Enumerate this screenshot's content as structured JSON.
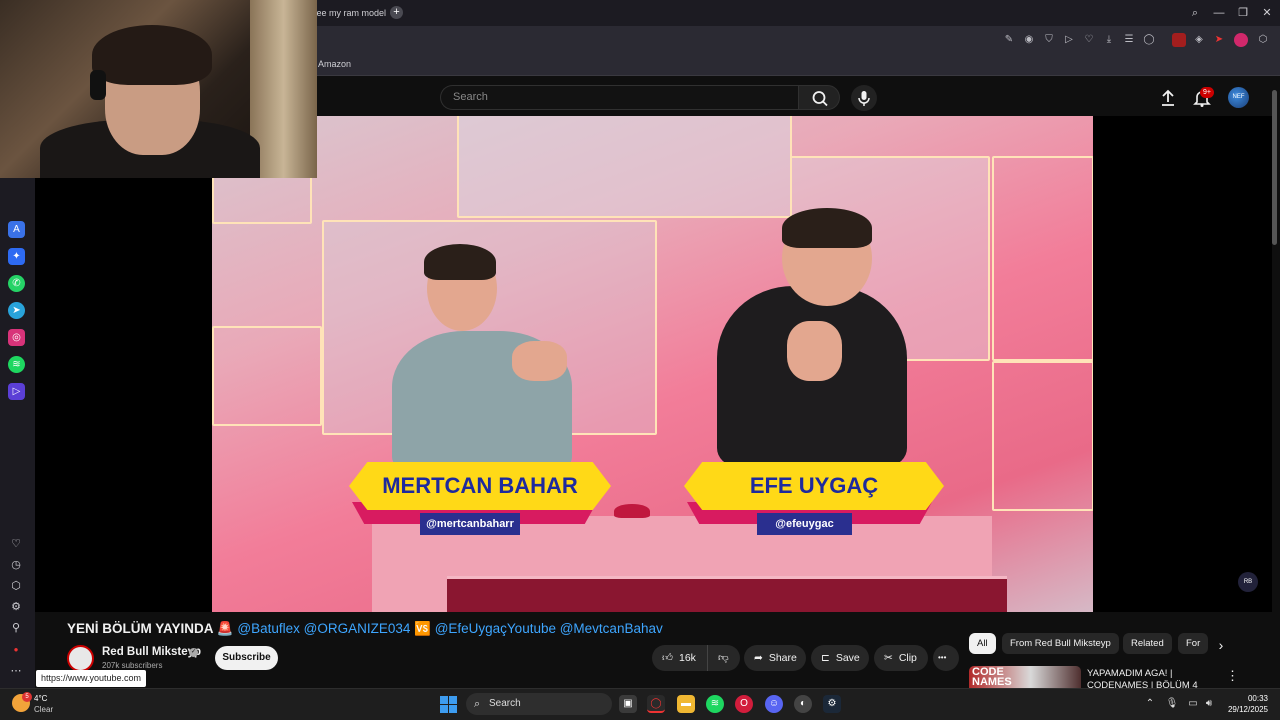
{
  "browser": {
    "tab_title": "see my ram model",
    "new_tab": "+",
    "bookmark": "Amazon",
    "window": {
      "minimize": "—",
      "restore": "❐",
      "close": "✕",
      "search": "⌕"
    }
  },
  "youtube": {
    "search_placeholder": "Search",
    "notification_count": "9+",
    "avatar_text": "NEF"
  },
  "video": {
    "left_name": "MERTCAN BAHAR",
    "left_handle": "@mertcanbaharr",
    "right_name": "EFE UYGAÇ",
    "right_handle": "@efeuygac",
    "title_prefix": "YENİ BÖLÜM YAYINDA 🚨",
    "mention_1": "@Batuflex @ORGANIZE034",
    "vs": "🆚",
    "mention_2": "@EfeUygaçYoutube @MevtcanBahav"
  },
  "channel": {
    "name": "Red Bull Miksteyp",
    "verified": "✓",
    "subscribers": "207k subscribers",
    "subscribe_label": "Subscribe"
  },
  "actions": {
    "likes": "16k",
    "share": "Share",
    "save": "Save",
    "clip": "Clip",
    "more": "•••"
  },
  "tooltip_url": "https://www.youtube.com",
  "chips": [
    "All",
    "From Red Bull Miksteyp",
    "Related",
    "For"
  ],
  "recommendation": {
    "thumb_text": "CODE NAMES",
    "title": "YAPAMADIM AGA! | CODENAMES | BÖLÜM 4"
  },
  "taskbar": {
    "temp": "4°C",
    "condition": "Clear",
    "weather_badge": "5",
    "search": "Search",
    "time": "00:33",
    "date": "29/12/2025"
  },
  "colors": {
    "nameplate_yellow": "#ffd917",
    "nameplate_blue": "#1e2a9e",
    "mention_blue": "#3ea6ff",
    "youtube_red": "#cc0000"
  }
}
